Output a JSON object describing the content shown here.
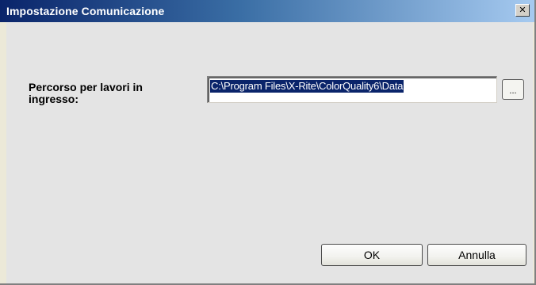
{
  "window": {
    "title": "Impostazione Comunicazione",
    "close_label": "✕"
  },
  "form": {
    "incoming_jobs_label": "Percorso per lavori in ingresso:",
    "incoming_jobs_path": "C:\\Program Files\\X-Rite\\ColorQuality6\\Data",
    "browse_label": "..."
  },
  "buttons": {
    "ok_label": "OK",
    "cancel_label": "Annulla"
  },
  "colors": {
    "titlebar_start": "#0a246a",
    "titlebar_end": "#a6caf0",
    "selection": "#0a246a",
    "client_bg": "#e4e4e4"
  }
}
